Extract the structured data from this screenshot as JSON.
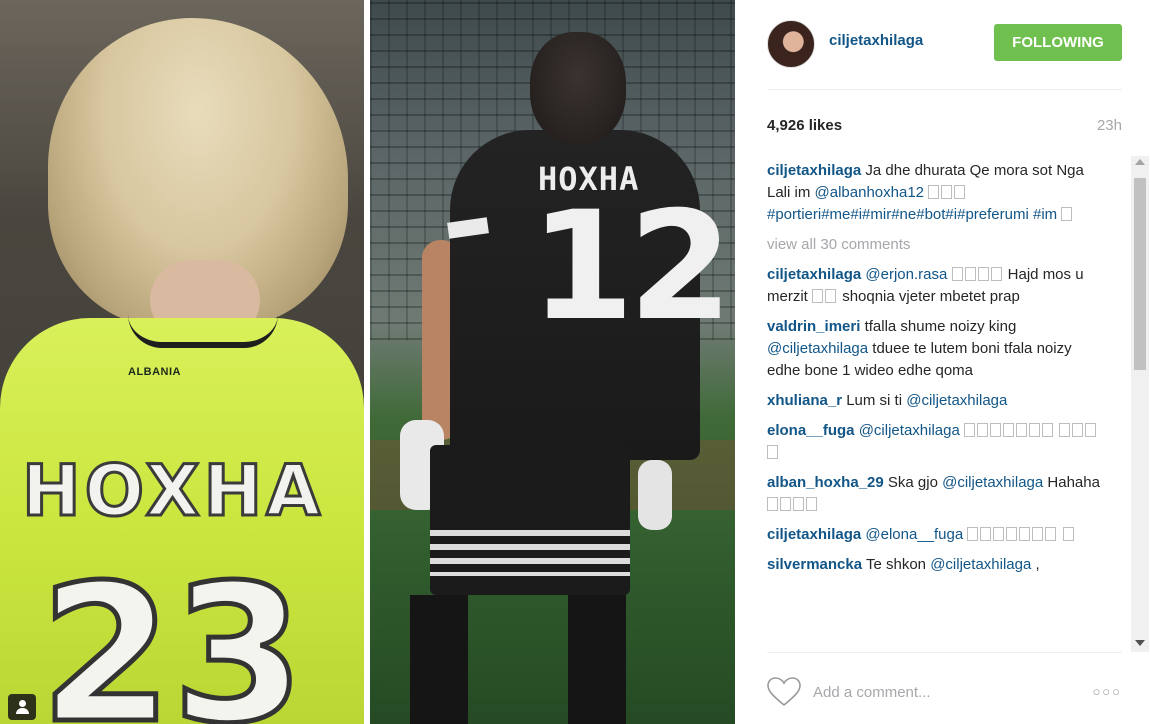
{
  "post": {
    "owner": "ciljetaxhilaga",
    "follow_label": "FOLLOWING",
    "likes": "4,926 likes",
    "age": "23h",
    "caption": {
      "user": "ciljetaxhilaga",
      "text1": "Ja dhe dhurata Qe mora sot Nga Lali im",
      "mention": "@albanhoxha12",
      "hashtags": "#portieri#me#i#mir#ne#bot#i#preferumi #im"
    },
    "view_all": "view all 30 comments"
  },
  "comments": [
    {
      "user": "ciljetaxhilaga",
      "mention": "@erjon.rasa",
      "text": "Hajd mos u merzit",
      "text2": "shoqnia vjeter mbetet prap"
    },
    {
      "user": "valdrin_imeri",
      "text": "tfalla shume noizy king",
      "mention": "@ciljetaxhilaga",
      "text2": "tduee te lutem boni tfala noizy edhe bone 1 wideo edhe qoma"
    },
    {
      "user": "xhuliana_r",
      "text": "Lum si ti",
      "mention": "@ciljetaxhilaga"
    },
    {
      "user": "elona__fuga",
      "mention": "@ciljetaxhilaga"
    },
    {
      "user": "alban_hoxha_29",
      "text": "Ska gjo",
      "mention": "@ciljetaxhilaga",
      "text2": "Hahaha"
    },
    {
      "user": "ciljetaxhilaga",
      "mention": "@elona__fuga"
    },
    {
      "user": "silvermancka",
      "text": "Te shkon",
      "mention": "@ciljetaxhilaga",
      "text2": ","
    }
  ],
  "composer": {
    "placeholder": "Add a comment..."
  },
  "photo": {
    "left_mark": "ALBANIA",
    "left_name": "HOXHA",
    "left_number": "23",
    "right_name": "HOXHA",
    "right_number": "12"
  },
  "icons": {
    "heart": "heart-outline-icon",
    "more": "ellipsis-icon",
    "user_tag": "user-icon"
  },
  "colors": {
    "link": "#125688",
    "follow_bg": "#70c050",
    "muted": "#a5a7aa"
  }
}
